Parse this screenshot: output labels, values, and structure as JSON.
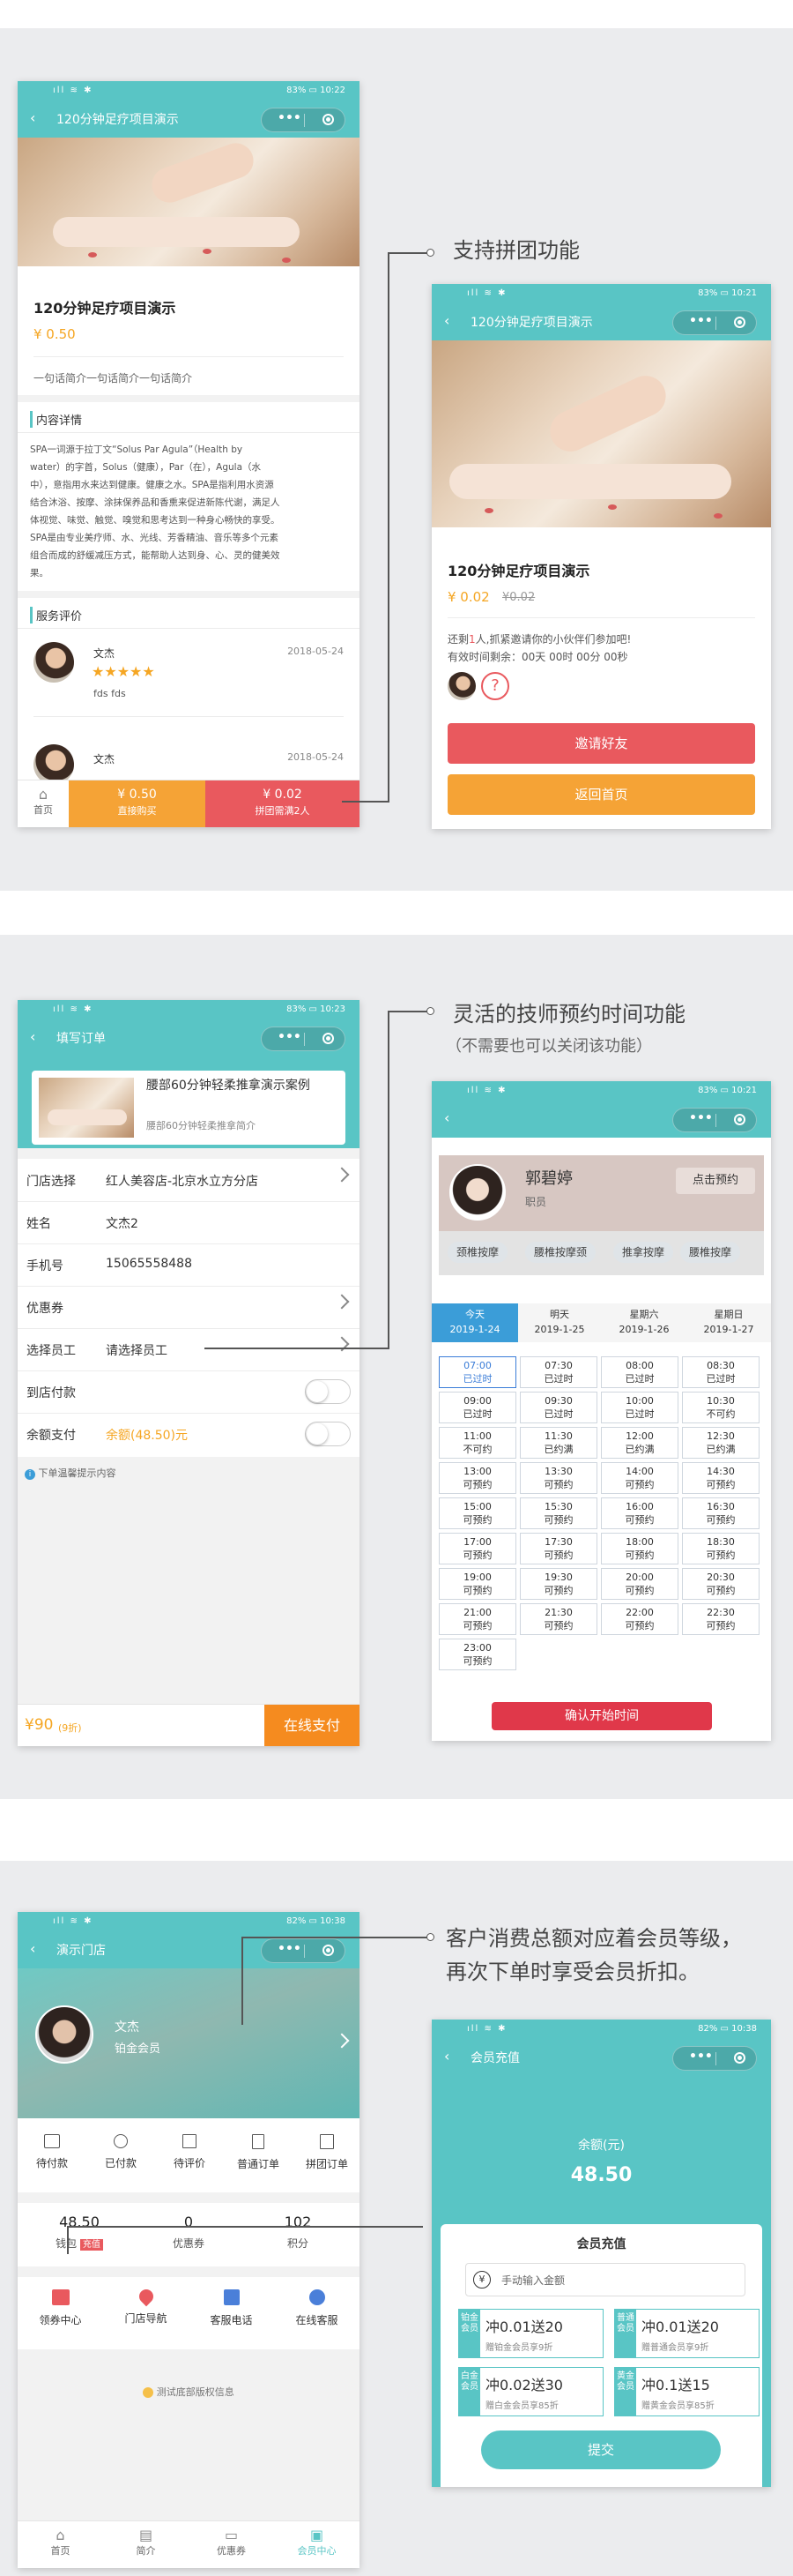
{
  "colors": {
    "teal": "#59c5c5",
    "orange": "#f5a336",
    "red": "#e9595e",
    "price": "#f5a623",
    "bg": "#ebecee"
  },
  "common": {
    "signal": "ıll ≋ ✱",
    "back": "‹",
    "capsule_dots": "•••"
  },
  "s1": {
    "p1": {
      "status_right": "83% ▭ 10:22",
      "nav_title": "120分钟足疗项目演示",
      "product_title": "120分钟足疗项目演示",
      "price": "¥ 0.50",
      "brief": "一句话简介一句话简介一句话简介",
      "detail_heading": "内容详情",
      "detail_lines": [
        "SPA一词源于拉丁文“Solus Par Agula”（Health by",
        "water）的字首，Solus（健康），Par（在），Agula（水",
        "中），意指用水来达到健康。健康之水。SPA是指利用水资源",
        "结合沐浴、按摩、涂抹保养品和香熏来促进新陈代谢，满足人",
        "体视觉、味觉、触觉、嗅觉和思考达到一种身心畅快的享受。",
        "SPA是由专业美疗师、水、光线、芳香精油、音乐等多个元素",
        "组合而成的舒缓减压方式，能帮助人达到身、心、灵的健美效",
        "果。"
      ],
      "review_heading": "服务评价",
      "reviews": [
        {
          "name": "文杰",
          "date": "2018-05-24",
          "stars": "★★★★★",
          "text": "fds fds"
        },
        {
          "name": "文杰",
          "date": "2018-05-24",
          "stars": "★★★★★",
          "text": ""
        }
      ],
      "tab_home": "首页",
      "buy_price": "¥ 0.50",
      "buy_label": "直接购买",
      "group_price": "¥ 0.02",
      "group_label": "拼团需满2人"
    },
    "annotation": "支持拼团功能",
    "p2": {
      "status_right": "83% ▭ 10:21",
      "nav_title": "120分钟足疗项目演示",
      "product_title": "120分钟足疗项目演示",
      "price": "¥ 0.02",
      "orig_price": "¥0.02",
      "invite_pre": "还剩",
      "invite_num": "1",
      "invite_post": "人,抓紧邀请你的小伙伴们参加吧!",
      "countdown": "有效时间剩余：00天 00时 00分 00秒",
      "q_mark": "?",
      "invite_btn": "邀请好友",
      "home_btn": "返回首页"
    }
  },
  "s2": {
    "p1": {
      "status_right": "83% ▭ 10:23",
      "nav_title": "填写订单",
      "item_title": "腰部60分钟轻柔推拿演示案例",
      "item_sub": "腰部60分钟轻柔推拿简介",
      "rows": [
        {
          "k": "门店选择",
          "v": "红人美容店-北京水立方分店"
        },
        {
          "k": "姓名",
          "v": "文杰2"
        },
        {
          "k": "手机号",
          "v": "15065558488"
        },
        {
          "k": "优惠券",
          "v": ""
        },
        {
          "k": "选择员工",
          "v": "请选择员工"
        },
        {
          "k": "到店付款",
          "v": ""
        },
        {
          "k": "余额支付",
          "v": "余额(48.50)元"
        }
      ],
      "tip": "下单温馨提示内容",
      "total": "¥90",
      "total_note": "(9折)",
      "pay_btn": "在线支付"
    },
    "annotation": "灵活的技师预约时间功能",
    "annotation_sub": "（不需要也可以关闭该功能）",
    "p2": {
      "status_right": "83% ▭ 10:21",
      "tech_name": "郭碧婷",
      "tech_role": "职员",
      "book_btn": "点击预约",
      "tags": [
        "颈椎按摩",
        "腰椎按摩颈",
        "推拿按摩",
        "腰椎按摩"
      ],
      "days": [
        {
          "w": "今天",
          "d": "2019-1-24"
        },
        {
          "w": "明天",
          "d": "2019-1-25"
        },
        {
          "w": "星期六",
          "d": "2019-1-26"
        },
        {
          "w": "星期日",
          "d": "2019-1-27"
        }
      ],
      "slots": [
        {
          "t": "07:00",
          "s": "已过时"
        },
        {
          "t": "07:30",
          "s": "已过时"
        },
        {
          "t": "08:00",
          "s": "已过时"
        },
        {
          "t": "08:30",
          "s": "已过时"
        },
        {
          "t": "09:00",
          "s": "已过时"
        },
        {
          "t": "09:30",
          "s": "已过时"
        },
        {
          "t": "10:00",
          "s": "已过时"
        },
        {
          "t": "10:30",
          "s": "不可约"
        },
        {
          "t": "11:00",
          "s": "不可约"
        },
        {
          "t": "11:30",
          "s": "已约满"
        },
        {
          "t": "12:00",
          "s": "已约满"
        },
        {
          "t": "12:30",
          "s": "已约满"
        },
        {
          "t": "13:00",
          "s": "可预约"
        },
        {
          "t": "13:30",
          "s": "可预约"
        },
        {
          "t": "14:00",
          "s": "可预约"
        },
        {
          "t": "14:30",
          "s": "可预约"
        },
        {
          "t": "15:00",
          "s": "可预约"
        },
        {
          "t": "15:30",
          "s": "可预约"
        },
        {
          "t": "16:00",
          "s": "可预约"
        },
        {
          "t": "16:30",
          "s": "可预约"
        },
        {
          "t": "17:00",
          "s": "可预约"
        },
        {
          "t": "17:30",
          "s": "可预约"
        },
        {
          "t": "18:00",
          "s": "可预约"
        },
        {
          "t": "18:30",
          "s": "可预约"
        },
        {
          "t": "19:00",
          "s": "可预约"
        },
        {
          "t": "19:30",
          "s": "可预约"
        },
        {
          "t": "20:00",
          "s": "可预约"
        },
        {
          "t": "20:30",
          "s": "可预约"
        },
        {
          "t": "21:00",
          "s": "可预约"
        },
        {
          "t": "21:30",
          "s": "可预约"
        },
        {
          "t": "22:00",
          "s": "可预约"
        },
        {
          "t": "22:30",
          "s": "可预约"
        },
        {
          "t": "23:00",
          "s": "可预约"
        }
      ],
      "confirm_btn": "确认开始时间"
    }
  },
  "s3": {
    "p1": {
      "status_right": "82% ▭ 10:38",
      "nav_title": "演示门店",
      "user_name": "文杰",
      "member_level": "铂金会员",
      "orders": [
        "待付款",
        "已付款",
        "待评价",
        "普通订单",
        "拼团订单"
      ],
      "wallet_val": "48.50",
      "wallet_label": "钱包",
      "recharge_tag": "充值",
      "coupon_val": "0",
      "coupon_label": "优惠券",
      "points_val": "102",
      "points_label": "积分",
      "services": [
        "领券中心",
        "门店导航",
        "客服电话",
        "在线客服"
      ],
      "copyright": "测试底部版权信息",
      "tabs": [
        "首页",
        "简介",
        "优惠券",
        "会员中心"
      ]
    },
    "annotation_1": "客户消费总额对应着会员等级，",
    "annotation_2": "再次下单时享受会员折扣。",
    "p2": {
      "status_right": "82% ▭ 10:38",
      "nav_title": "会员充值",
      "balance_label": "余额(元)",
      "balance": "48.50",
      "panel_title": "会员充值",
      "currency": "¥",
      "input_placeholder": "手动输入金额",
      "cards": [
        {
          "side": "铂金会员",
          "big": "冲0.01送20",
          "small": "赠铂金会员享9折"
        },
        {
          "side": "普通会员",
          "big": "冲0.01送20",
          "small": "赠普通会员享9折"
        },
        {
          "side": "白金会员",
          "big": "冲0.02送30",
          "small": "赠白金会员享85折"
        },
        {
          "side": "黄金会员",
          "big": "冲0.1送15",
          "small": "赠黄金会员享85折"
        }
      ],
      "submit_btn": "提交"
    }
  }
}
